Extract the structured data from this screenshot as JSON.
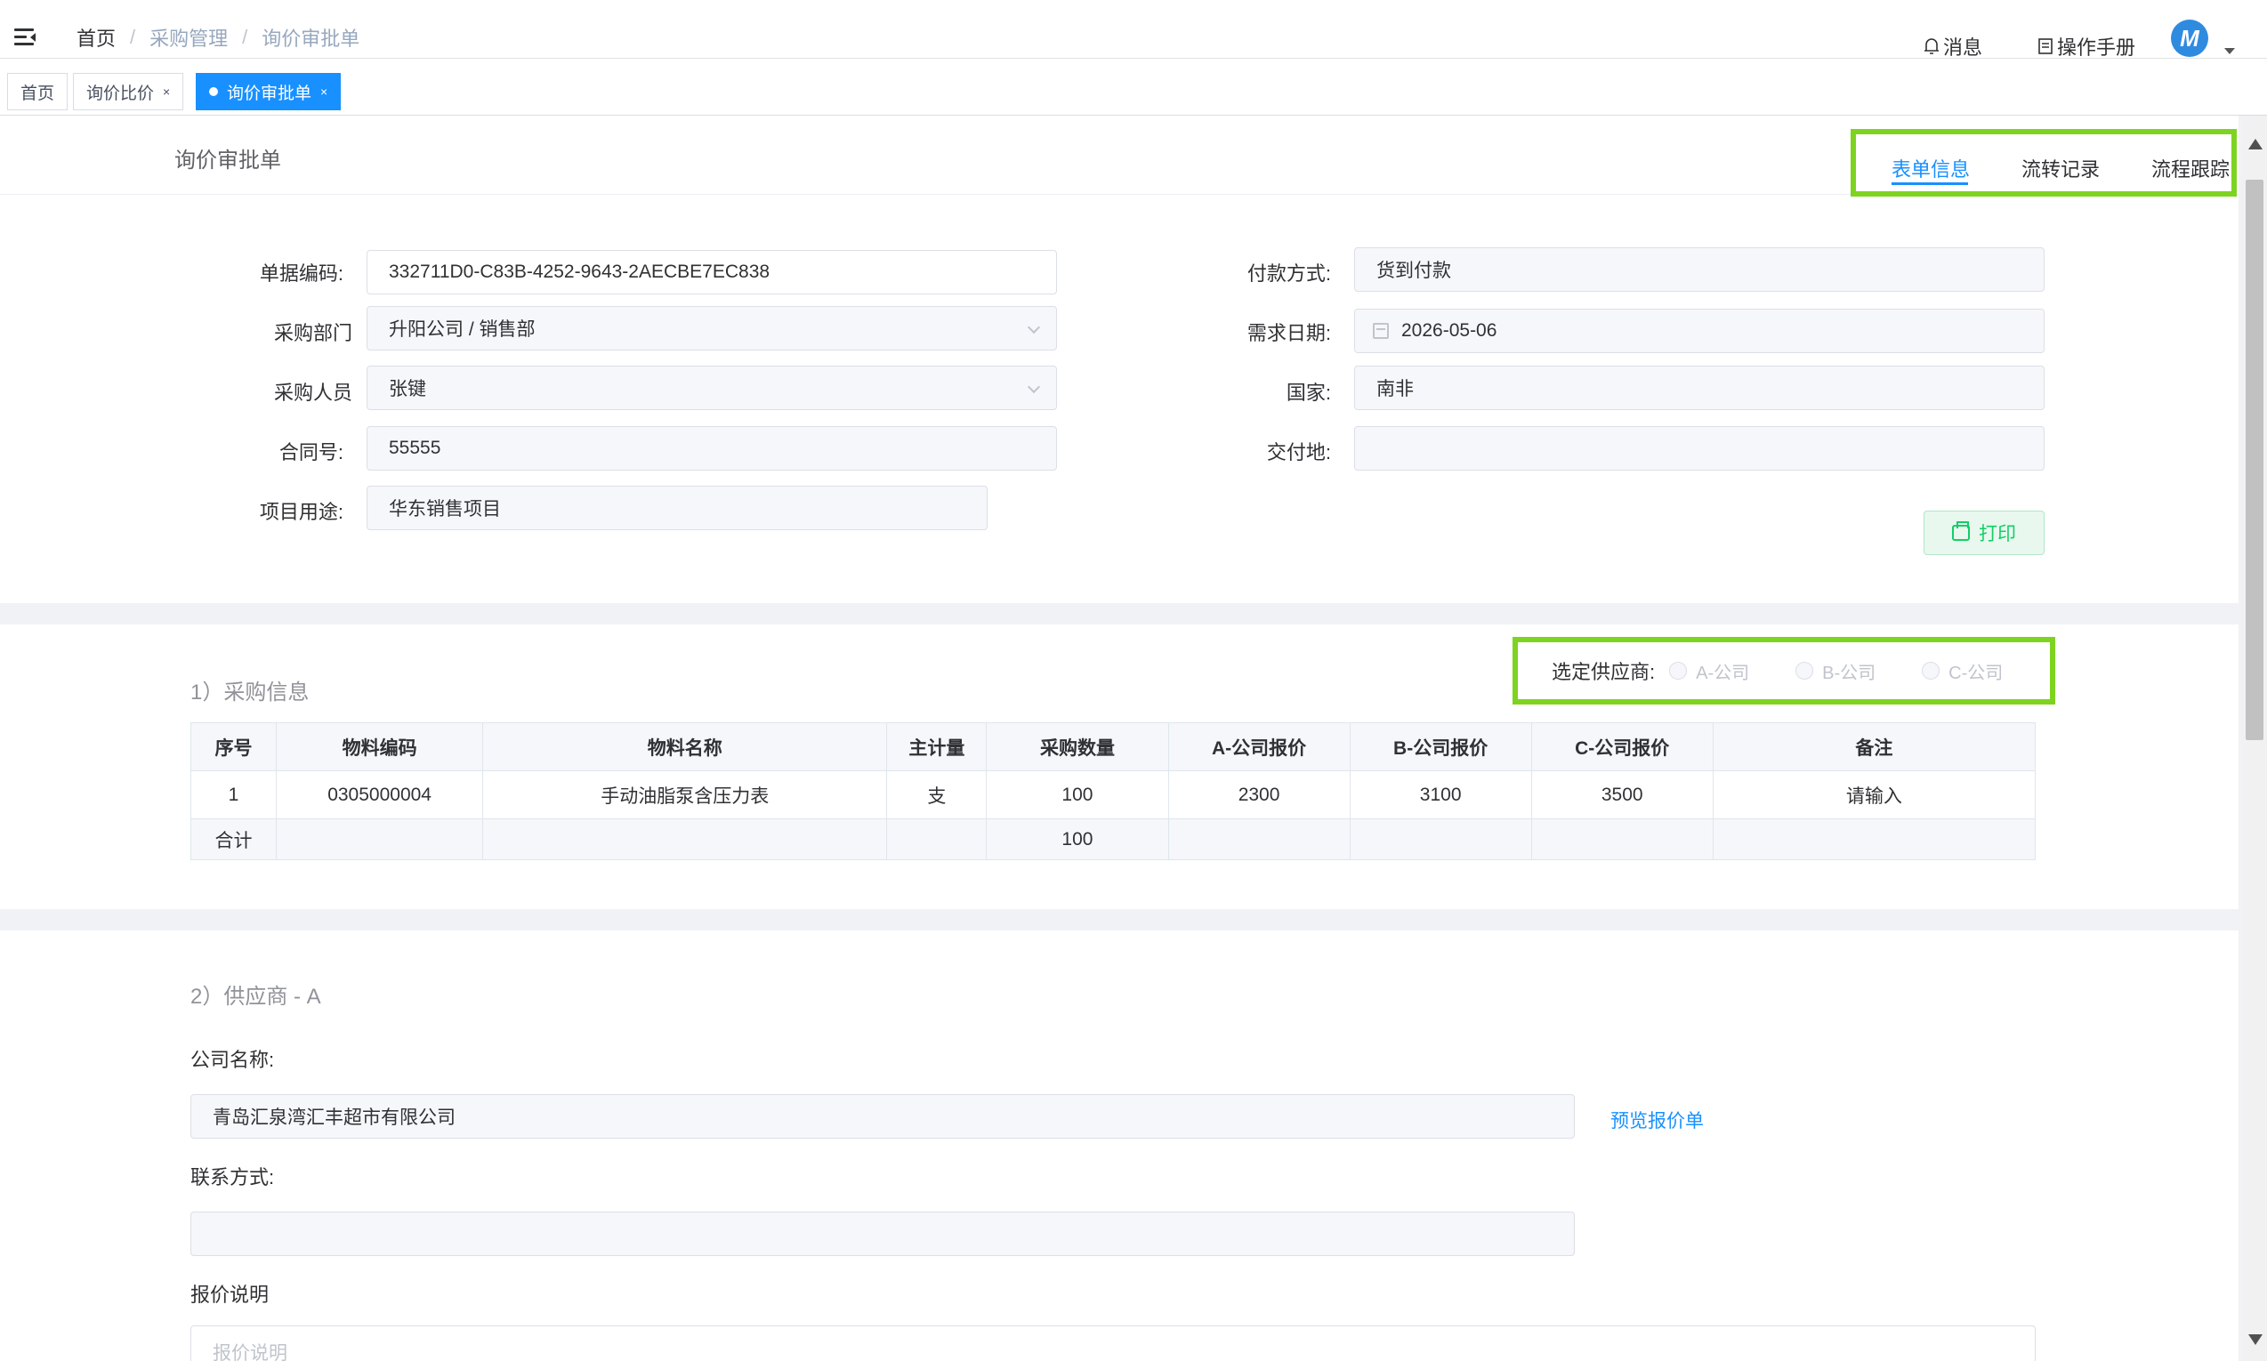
{
  "navbar": {
    "breadcrumb": [
      "首页",
      "采购管理",
      "询价审批单"
    ],
    "breadcrumb_sep": "/",
    "message_label": "消息",
    "manual_label": "操作手册",
    "avatar_letter": "M"
  },
  "tags": [
    {
      "label": "首页",
      "active": false,
      "closable": false
    },
    {
      "label": "询价比价",
      "active": false,
      "closable": true
    },
    {
      "label": "询价审批单",
      "active": true,
      "closable": true
    }
  ],
  "tag_close": "×",
  "page": {
    "title": "询价审批单",
    "tabs": [
      "表单信息",
      "流转记录",
      "流程跟踪"
    ],
    "active_tab": "表单信息"
  },
  "form": {
    "doc_code_label": "单据编码:",
    "doc_code": "332711D0-C83B-4252-9643-2AECBE7EC838",
    "dept_label": "采购部门",
    "dept": "升阳公司 / 销售部",
    "buyer_label": "采购人员",
    "buyer": "张键",
    "contract_label": "合同号:",
    "contract": "55555",
    "purpose_label": "项目用途:",
    "purpose": "华东销售项目",
    "payment_label": "付款方式:",
    "payment": "货到付款",
    "date_label": "需求日期:",
    "date": "2026-05-06",
    "country_label": "国家:",
    "country": "南非",
    "delivery_label": "交付地:",
    "delivery": "",
    "print_label": "打印"
  },
  "purchase": {
    "section_title": "1）采购信息",
    "supplier_label": "选定供应商:",
    "suppliers": [
      "A-公司",
      "B-公司",
      "C-公司"
    ],
    "columns": [
      "序号",
      "物料编码",
      "物料名称",
      "主计量",
      "采购数量",
      "A-公司报价",
      "B-公司报价",
      "C-公司报价",
      "备注"
    ],
    "rows": [
      {
        "no": "1",
        "code": "0305000004",
        "name": "手动油脂泵含压力表",
        "unit": "支",
        "qty": "100",
        "a": "2300",
        "b": "3100",
        "c": "3500",
        "remark_placeholder": "请输入"
      }
    ],
    "sum_label": "合计",
    "sum_qty": "100"
  },
  "supplier_a": {
    "section_title": "2）供应商 - A",
    "company_label": "公司名称:",
    "company": "青岛汇泉湾汇丰超市有限公司",
    "preview_link": "预览报价单",
    "contact_label": "联系方式:",
    "contact": "",
    "quote_label": "报价说明",
    "quote_placeholder": "报价说明"
  },
  "colors": {
    "accent": "#1890ff",
    "highlight": "#7ed321",
    "success": "#13ce66"
  }
}
